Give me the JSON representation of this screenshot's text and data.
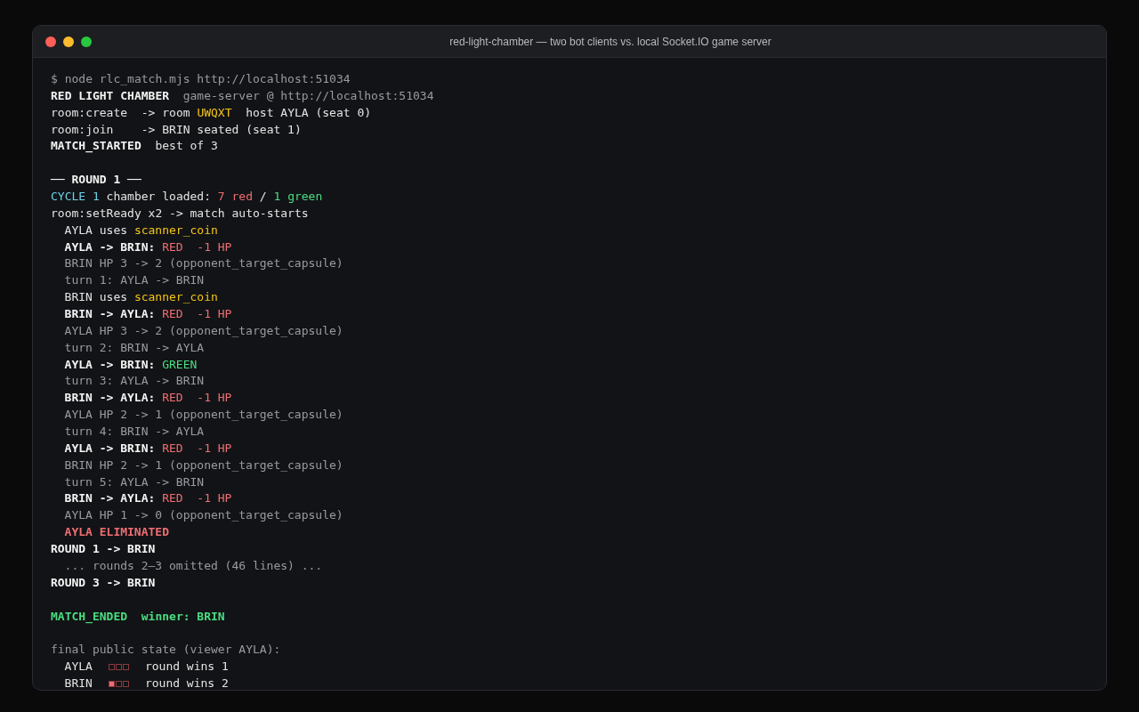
{
  "window": {
    "title": "red-light-chamber — two bot clients vs. local Socket.IO game server"
  },
  "lines": [
    {
      "kind": "text",
      "indent": false,
      "segments": [
        {
          "text": "$ node rlc_match.mjs http://localhost:51034",
          "kind": "dim"
        }
      ]
    },
    {
      "kind": "text",
      "indent": false,
      "segments": [
        {
          "text": "RED LIGHT CHAMBER",
          "kind": "bold"
        },
        {
          "text": "  game-server @ http://localhost:51034",
          "kind": "dim"
        }
      ]
    },
    {
      "kind": "text",
      "indent": false,
      "segments": [
        {
          "text": "room:create  -> room ",
          "kind": "plain"
        },
        {
          "text": "UWQXT",
          "kind": "yellow"
        },
        {
          "text": "  host AYLA (seat 0)",
          "kind": "plain"
        }
      ]
    },
    {
      "kind": "text",
      "indent": false,
      "segments": [
        {
          "text": "room:join    -> BRIN seated (seat 1)",
          "kind": "plain"
        }
      ]
    },
    {
      "kind": "text",
      "indent": false,
      "segments": [
        {
          "text": "MATCH_STARTED",
          "kind": "bold"
        },
        {
          "text": "  best of 3",
          "kind": "plain"
        }
      ]
    },
    {
      "kind": "blank"
    },
    {
      "kind": "text",
      "indent": false,
      "segments": [
        {
          "text": "── ROUND 1 ──",
          "kind": "bold"
        }
      ]
    },
    {
      "kind": "text",
      "indent": false,
      "segments": [
        {
          "text": "CYCLE 1",
          "kind": "cyan"
        },
        {
          "text": " chamber loaded: ",
          "kind": "plain"
        },
        {
          "text": "7 red",
          "kind": "red"
        },
        {
          "text": " / ",
          "kind": "plain"
        },
        {
          "text": "1 green",
          "kind": "green"
        }
      ]
    },
    {
      "kind": "text",
      "indent": false,
      "segments": [
        {
          "text": "room:setReady x2 -> match auto-starts",
          "kind": "plain"
        }
      ]
    },
    {
      "kind": "text",
      "indent": true,
      "segments": [
        {
          "text": "AYLA uses ",
          "kind": "plain"
        },
        {
          "text": "scanner_coin",
          "kind": "yellow"
        }
      ]
    },
    {
      "kind": "text",
      "indent": true,
      "segments": [
        {
          "text": "AYLA -> BRIN: ",
          "kind": "bold"
        },
        {
          "text": "RED  -1 HP",
          "kind": "red"
        }
      ]
    },
    {
      "kind": "text",
      "indent": true,
      "segments": [
        {
          "text": "BRIN HP 3 -> 2 (opponent_target_capsule)",
          "kind": "dim"
        }
      ]
    },
    {
      "kind": "text",
      "indent": true,
      "segments": [
        {
          "text": "turn 1: AYLA -> BRIN",
          "kind": "dim"
        }
      ]
    },
    {
      "kind": "text",
      "indent": true,
      "segments": [
        {
          "text": "BRIN uses ",
          "kind": "plain"
        },
        {
          "text": "scanner_coin",
          "kind": "yellow"
        }
      ]
    },
    {
      "kind": "text",
      "indent": true,
      "segments": [
        {
          "text": "BRIN -> AYLA: ",
          "kind": "bold"
        },
        {
          "text": "RED  -1 HP",
          "kind": "red"
        }
      ]
    },
    {
      "kind": "text",
      "indent": true,
      "segments": [
        {
          "text": "AYLA HP 3 -> 2 (opponent_target_capsule)",
          "kind": "dim"
        }
      ]
    },
    {
      "kind": "text",
      "indent": true,
      "segments": [
        {
          "text": "turn 2: BRIN -> AYLA",
          "kind": "dim"
        }
      ]
    },
    {
      "kind": "text",
      "indent": true,
      "segments": [
        {
          "text": "AYLA -> BRIN: ",
          "kind": "bold"
        },
        {
          "text": "GREEN",
          "kind": "green"
        }
      ]
    },
    {
      "kind": "text",
      "indent": true,
      "segments": [
        {
          "text": "turn 3: AYLA -> BRIN",
          "kind": "dim"
        }
      ]
    },
    {
      "kind": "text",
      "indent": true,
      "segments": [
        {
          "text": "BRIN -> AYLA: ",
          "kind": "bold"
        },
        {
          "text": "RED  -1 HP",
          "kind": "red"
        }
      ]
    },
    {
      "kind": "text",
      "indent": true,
      "segments": [
        {
          "text": "AYLA HP 2 -> 1 (opponent_target_capsule)",
          "kind": "dim"
        }
      ]
    },
    {
      "kind": "text",
      "indent": true,
      "segments": [
        {
          "text": "turn 4: BRIN -> AYLA",
          "kind": "dim"
        }
      ]
    },
    {
      "kind": "text",
      "indent": true,
      "segments": [
        {
          "text": "AYLA -> BRIN: ",
          "kind": "bold"
        },
        {
          "text": "RED  -1 HP",
          "kind": "red"
        }
      ]
    },
    {
      "kind": "text",
      "indent": true,
      "segments": [
        {
          "text": "BRIN HP 2 -> 1 (opponent_target_capsule)",
          "kind": "dim"
        }
      ]
    },
    {
      "kind": "text",
      "indent": true,
      "segments": [
        {
          "text": "turn 5: AYLA -> BRIN",
          "kind": "dim"
        }
      ]
    },
    {
      "kind": "text",
      "indent": true,
      "segments": [
        {
          "text": "BRIN -> AYLA: ",
          "kind": "bold"
        },
        {
          "text": "RED  -1 HP",
          "kind": "red"
        }
      ]
    },
    {
      "kind": "text",
      "indent": true,
      "segments": [
        {
          "text": "AYLA HP 1 -> 0 (opponent_target_capsule)",
          "kind": "dim"
        }
      ]
    },
    {
      "kind": "text",
      "indent": true,
      "segments": [
        {
          "text": "AYLA ELIMINATED",
          "kind": "alert"
        }
      ]
    },
    {
      "kind": "text",
      "indent": false,
      "segments": [
        {
          "text": "ROUND 1 -> BRIN",
          "kind": "bold"
        }
      ]
    },
    {
      "kind": "text",
      "indent": true,
      "segments": [
        {
          "text": "... rounds 2–3 omitted (46 lines) ...",
          "kind": "dim"
        }
      ]
    },
    {
      "kind": "text",
      "indent": false,
      "segments": [
        {
          "text": "ROUND 3 -> BRIN",
          "kind": "bold"
        }
      ]
    },
    {
      "kind": "blank"
    },
    {
      "kind": "text",
      "indent": false,
      "segments": [
        {
          "text": "MATCH_ENDED  winner: BRIN",
          "kind": "success"
        }
      ]
    },
    {
      "kind": "blank"
    },
    {
      "kind": "text",
      "indent": false,
      "segments": [
        {
          "text": "final public state (viewer AYLA):",
          "kind": "dim"
        }
      ]
    },
    {
      "kind": "score",
      "indent": true,
      "name": "AYLA",
      "pips": [
        {
          "filled": false
        },
        {
          "filled": false
        },
        {
          "filled": false
        }
      ],
      "wins": "round wins 1"
    },
    {
      "kind": "score",
      "indent": true,
      "name": "BRIN",
      "pips": [
        {
          "filled": true
        },
        {
          "filled": false
        },
        {
          "filled": false
        }
      ],
      "wins": "round wins 2"
    }
  ]
}
